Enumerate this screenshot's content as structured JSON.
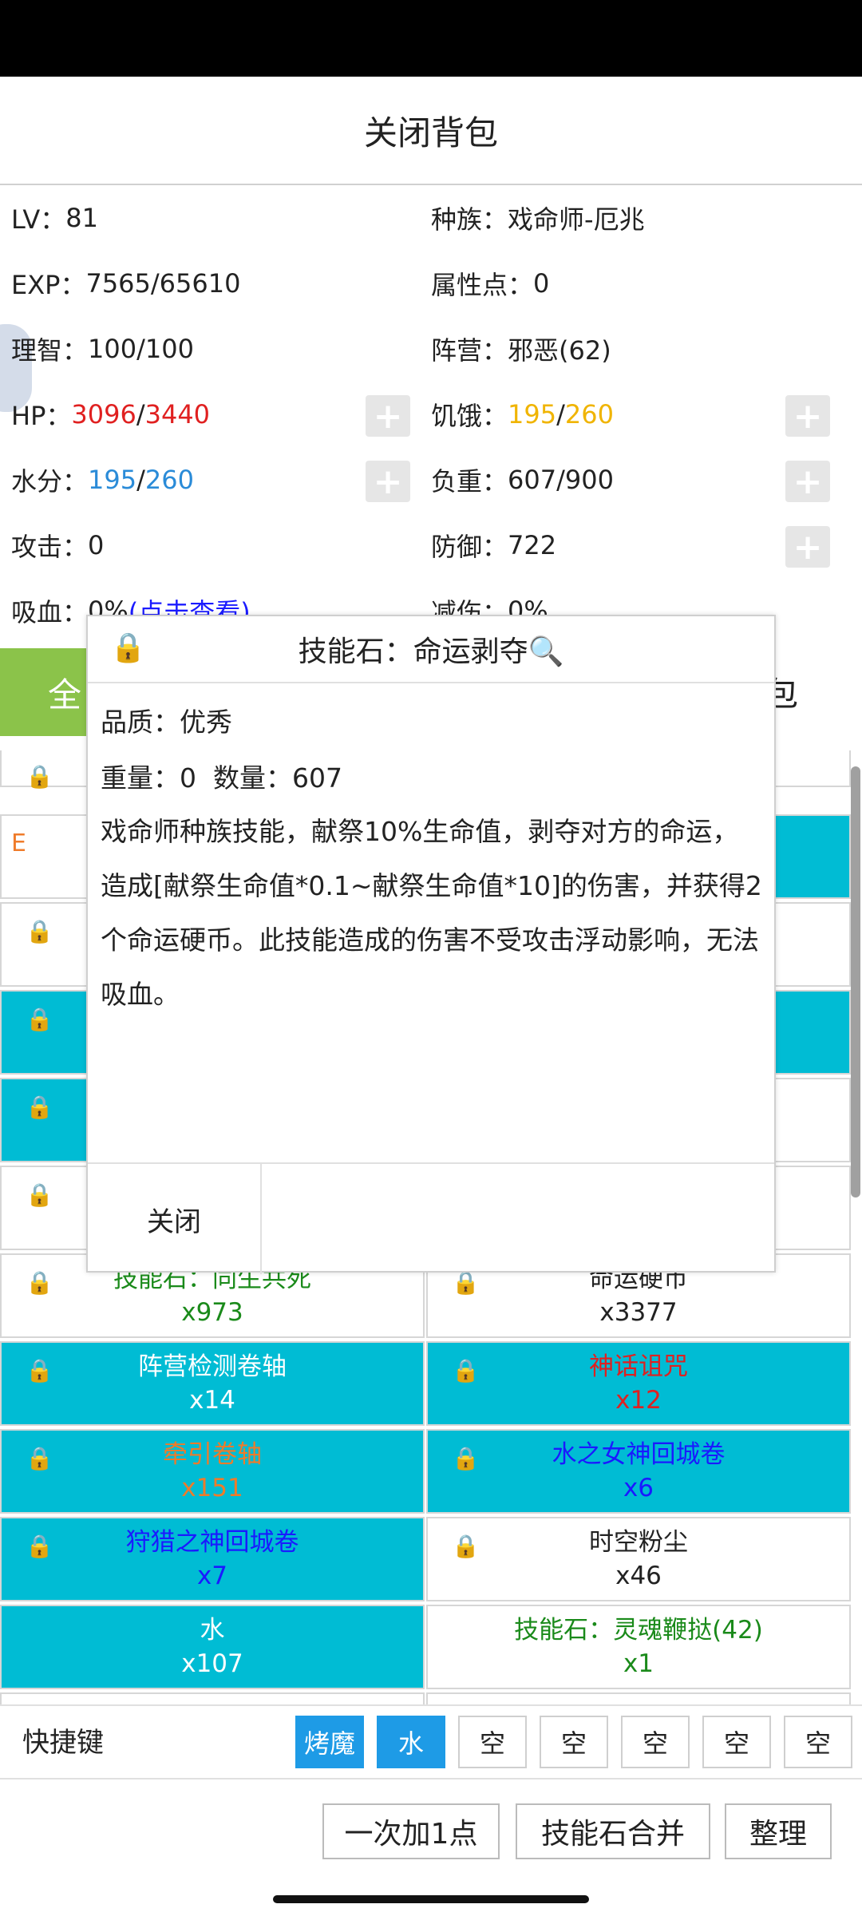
{
  "header": {
    "title": "关闭背包"
  },
  "stats": {
    "lv_label": "LV：",
    "lv_value": "81",
    "race_label": "种族：",
    "race_value": "戏命师-厄兆",
    "exp_label": "EXP：",
    "exp_value": "7565/65610",
    "attr_label": "属性点：",
    "attr_value": "0",
    "sanity_label": "理智：",
    "sanity_value": "100/100",
    "camp_label": "阵营：",
    "camp_value": "邪恶(62)",
    "hp_label": "HP：",
    "hp_cur": "3096",
    "hp_sep": "/",
    "hp_max": "3440",
    "hunger_label": "饥饿：",
    "hunger_cur": "195",
    "hunger_sep": "/",
    "hunger_max": "260",
    "water_label": "水分：",
    "water_cur": "195",
    "water_sep": "/",
    "water_max": "260",
    "load_label": "负重：",
    "load_value": "607/900",
    "atk_label": "攻击：",
    "atk_value": "0",
    "def_label": "防御：",
    "def_value": "722",
    "lifesteal_label": "吸血：",
    "lifesteal_value": "0%",
    "lifesteal_link": "(点击查看)",
    "reduce_label": "减伤：",
    "reduce_value": "0%",
    "plus": "+"
  },
  "tabs": {
    "left_char": "全",
    "right_char": "包"
  },
  "grid": {
    "lock": "🔒",
    "partial_e": "E",
    "items": [
      {
        "name": "技能石：同生共死",
        "count": "x973",
        "color": "green",
        "bg": "white"
      },
      {
        "name": "命运硬币",
        "count": "x3377",
        "color": "black",
        "bg": "white"
      },
      {
        "name": "阵营检测卷轴",
        "count": "x14",
        "color": "white",
        "bg": "cyan"
      },
      {
        "name": "神话诅咒",
        "count": "x12",
        "color": "red",
        "bg": "cyan"
      },
      {
        "name": "牵引卷轴",
        "count": "x151",
        "color": "orange",
        "bg": "cyan"
      },
      {
        "name": "水之女神回城卷",
        "count": "x6",
        "color": "blue",
        "bg": "cyan"
      },
      {
        "name": "狩猎之神回城卷",
        "count": "x7",
        "color": "blue",
        "bg": "cyan"
      },
      {
        "name": "时空粉尘",
        "count": "x46",
        "color": "black",
        "bg": "white"
      },
      {
        "name": "水",
        "count": "x107",
        "color": "white",
        "bg": "cyan"
      },
      {
        "name": "技能石：灵魂鞭挞(42)",
        "count": "x1",
        "color": "green",
        "bg": "white"
      }
    ],
    "partial_paren": ")"
  },
  "shortcuts": {
    "label": "快捷键",
    "slots": [
      "烤魔",
      "水",
      "空",
      "空",
      "空",
      "空",
      "空"
    ]
  },
  "bottom": {
    "add_one": "一次加1点",
    "merge": "技能石合并",
    "sort": "整理"
  },
  "modal": {
    "lock": "🔒",
    "title": "技能石：命运剥夺🔍",
    "quality_label": "品质：",
    "quality_value": "优秀",
    "weight_label": "重量：",
    "weight_value": "0",
    "count_label": "数量：",
    "count_value": "607",
    "description": "戏命师种族技能，献祭10%生命值，剥夺对方的命运，造成[献祭生命值*0.1~献祭生命值*10]的伤害，并获得2个命运硬币。此技能造成的伤害不受攻击浮动影响，无法吸血。",
    "close": "关闭"
  }
}
